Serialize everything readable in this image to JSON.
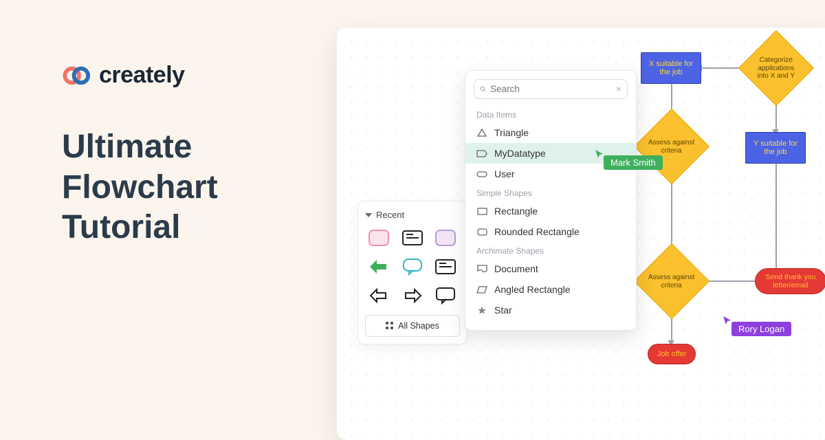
{
  "brand": {
    "name": "creately"
  },
  "headline": {
    "line1": "Ultimate",
    "line2": "Flowchart",
    "line3": "Tutorial"
  },
  "shape_panel": {
    "recent_label": "Recent",
    "all_shapes_label": "All Shapes"
  },
  "dropdown": {
    "search_placeholder": "Search",
    "sections": [
      {
        "title": "Data Items",
        "items": [
          "Triangle",
          "MyDatatype",
          "User"
        ],
        "selected_index": 1
      },
      {
        "title": "Simple Shapes",
        "items": [
          "Rectangle",
          "Rounded Rectangle"
        ]
      },
      {
        "title": "Archimate Shapes",
        "items": [
          "Document",
          "Angled Rectangle",
          "Star"
        ]
      }
    ]
  },
  "diagram": {
    "nodes": {
      "x_suitable": "X suitable for the job",
      "categorize": "Categorize applications into X and Y",
      "assess1": "Assess against criteria",
      "y_suitable": "Y suitable for the job",
      "assess2": "Assess against criteria",
      "send_thanks": "Send thank you letter/email",
      "job_offer": "Job offer"
    }
  },
  "cursors": {
    "user1": "Mark Smith",
    "user2": "Rory Logan"
  },
  "colors": {
    "user1": "#3FAF5D",
    "user2": "#8E3FE0",
    "blue": "#4C63E6",
    "yellow": "#FBC02D",
    "red": "#E53935"
  }
}
